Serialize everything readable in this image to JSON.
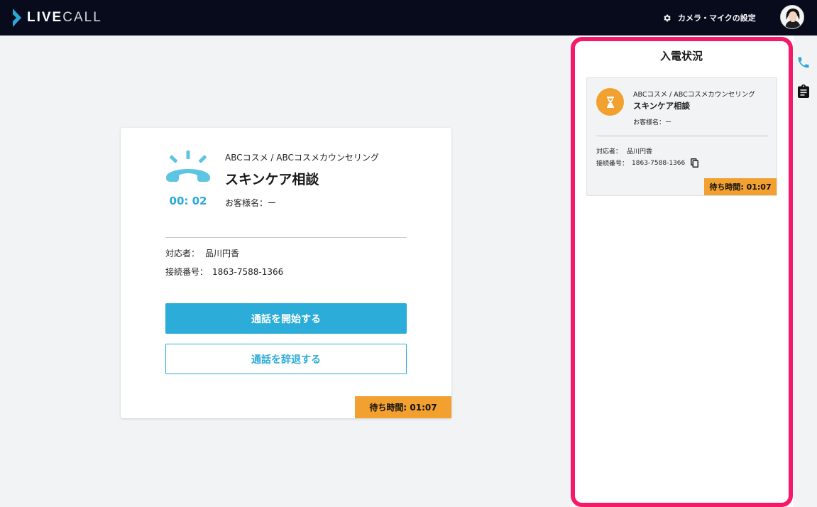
{
  "header": {
    "logo_text_left": "LIVE",
    "logo_text_right": "CALL",
    "settings_label": "カメラ・マイクの設定",
    "settings_icon": "gear-icon",
    "avatar_icon": "user-avatar"
  },
  "colors": {
    "header_bg": "#070b1c",
    "accent": "#2cacd9",
    "wait_badge": "#f2a02f",
    "panel_highlight": "#f51a69"
  },
  "call": {
    "status_icon": "ringing-phone-icon",
    "timer": "00: 02",
    "shop": "ABCコスメ / ABCコスメカウンセリング",
    "title": "スキンケア相談",
    "customer_label": "お客様名：",
    "customer_value": "ー",
    "agent_label": "対応者：",
    "agent_value": "品川円香",
    "number_label": "接続番号：",
    "number_value": "1863-7588-1366",
    "start_button": "通話を開始する",
    "decline_button": "通話を辞退する",
    "wait_label": "待ち時間: 01:07"
  },
  "panel": {
    "title": "入電状況",
    "card": {
      "icon": "hourglass-icon",
      "shop": "ABCコスメ / ABCコスメカウンセリング",
      "title": "スキンケア相談",
      "customer_label": "お客様名：",
      "customer_value": "ー",
      "agent_label": "対応者：",
      "agent_value": "品川円香",
      "number_label": "接続番号：",
      "number_value": "1863-7588-1366",
      "copy_icon": "copy-icon",
      "wait_label": "待ち時間: 01:07"
    }
  },
  "side_icons": [
    "phone-icon",
    "clipboard-icon"
  ]
}
